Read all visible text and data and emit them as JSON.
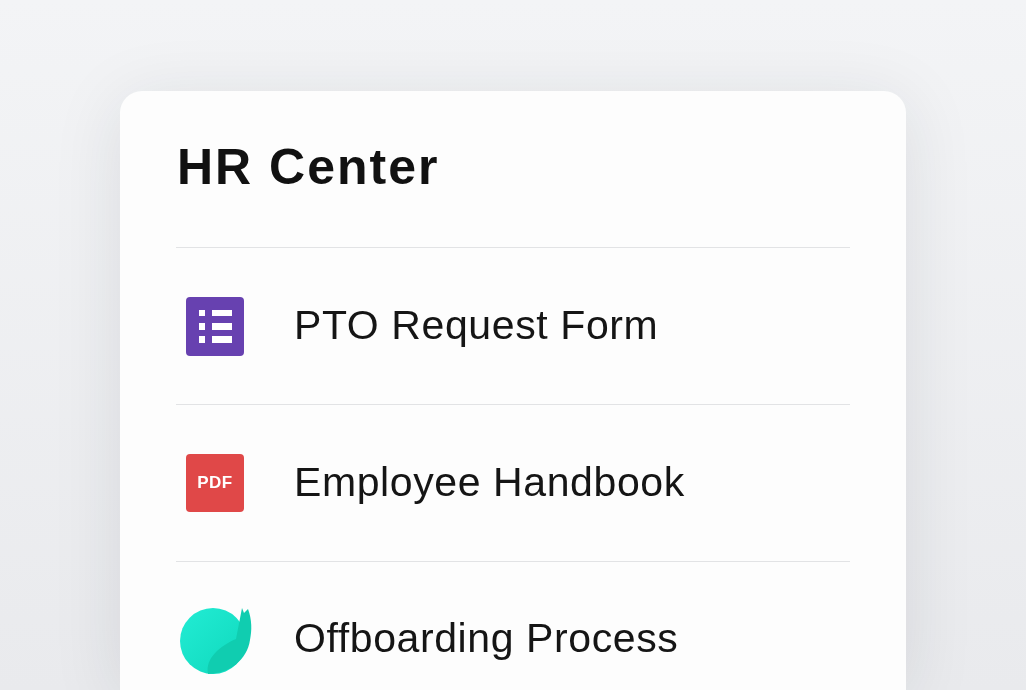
{
  "title": "HR Center",
  "items": [
    {
      "kind": "form",
      "label": "PTO Request Form"
    },
    {
      "kind": "pdf",
      "icon_text": "PDF",
      "label": "Employee Handbook"
    },
    {
      "kind": "leaf",
      "label": "Offboarding Process"
    }
  ]
}
